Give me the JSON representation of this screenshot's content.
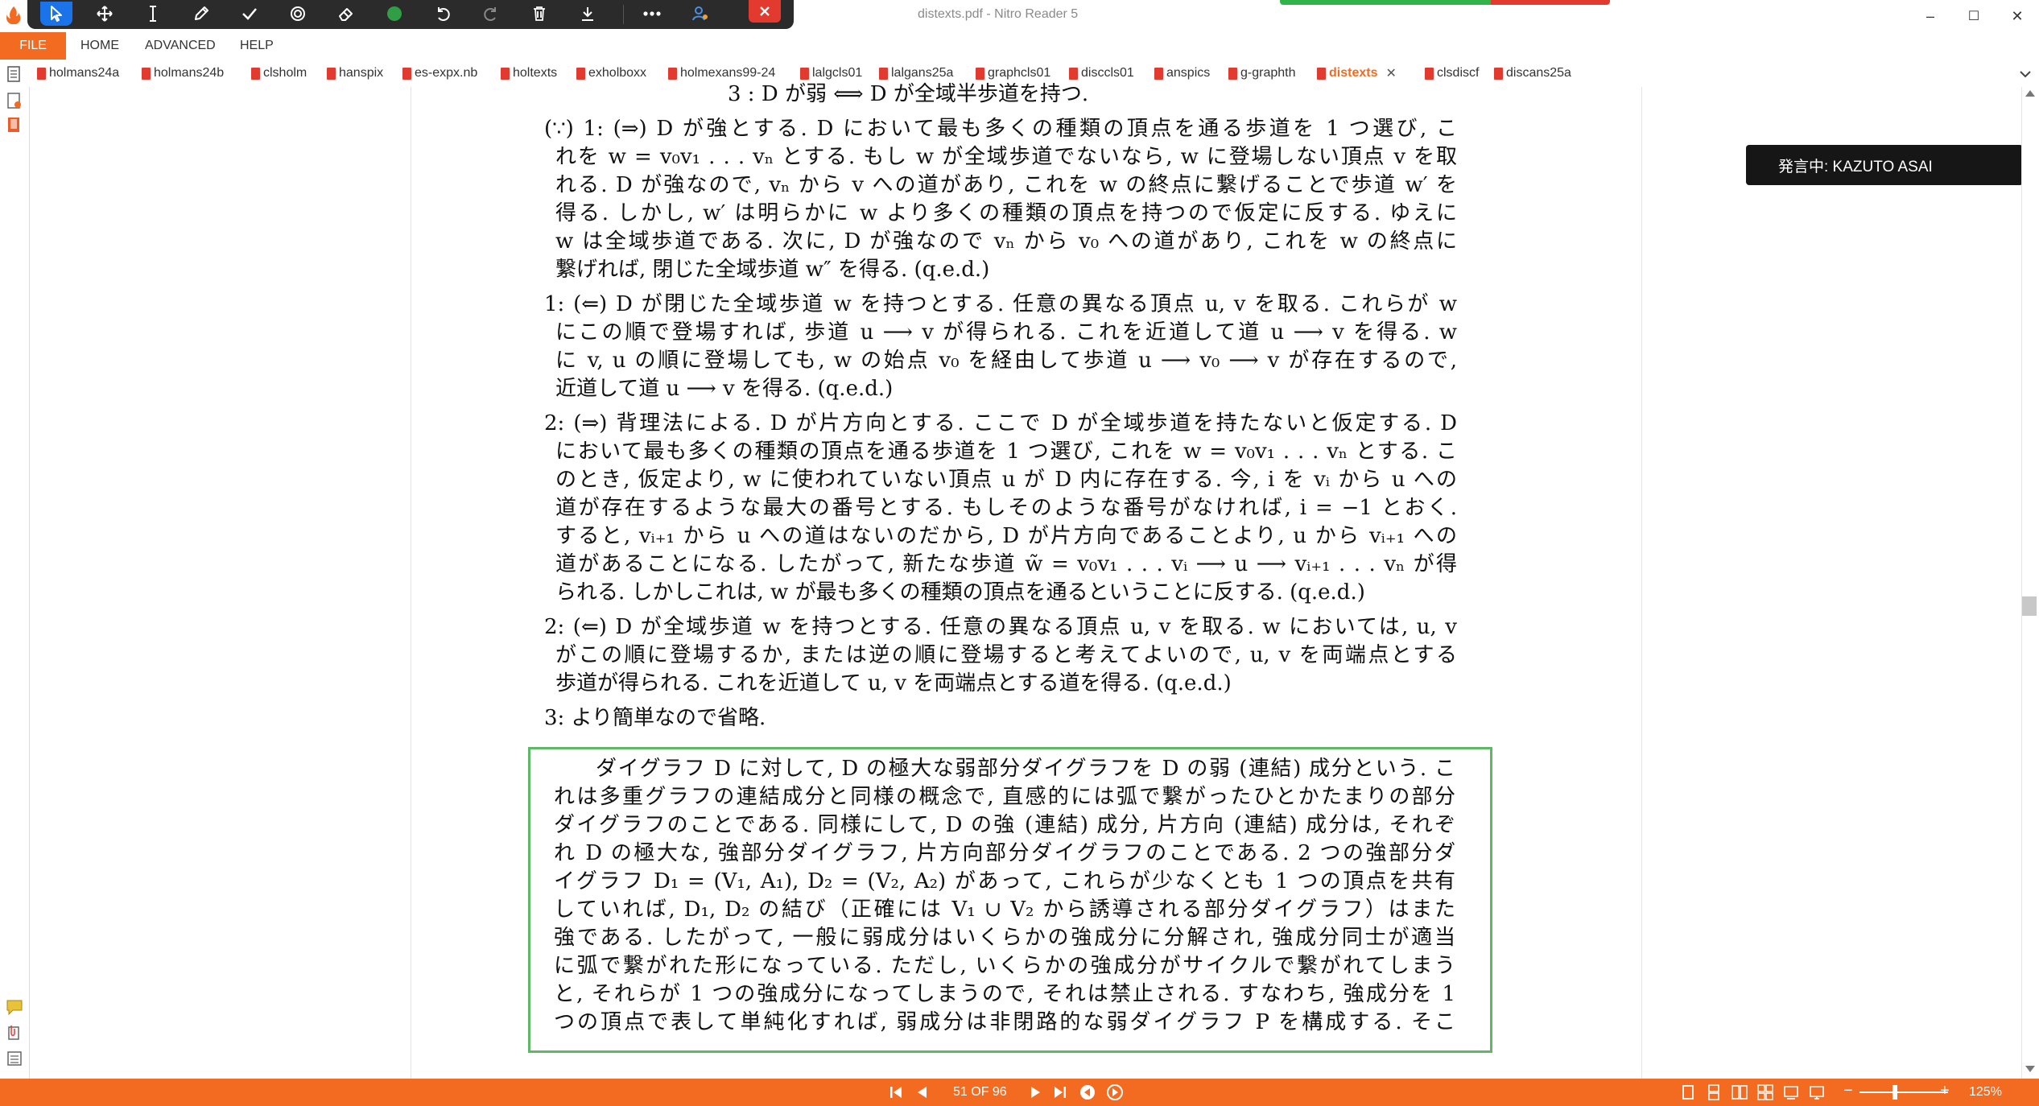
{
  "window": {
    "title": "distexts.pdf - Nitro Reader 5",
    "minimize": "–",
    "maximize": "☐",
    "close": "✕"
  },
  "toolbar": {
    "tools": [
      "select-arrow-icon",
      "pan-icon",
      "text-cursor-icon",
      "pen-icon",
      "check-icon",
      "stamp-icon",
      "eraser-icon",
      "color-dot-icon",
      "undo-icon",
      "redo-icon",
      "trash-icon",
      "download-icon",
      "more-icon",
      "user-icon",
      "close-icon"
    ],
    "active_color": "#1a73e8",
    "dot_color": "#2f9e44"
  },
  "menu": {
    "file": "FILE",
    "home": "HOME",
    "advanced": "ADVANCED",
    "help": "HELP"
  },
  "tabs": [
    {
      "label": "holmans24a"
    },
    {
      "label": "holmans24b"
    },
    {
      "label": "clsholm"
    },
    {
      "label": "hanspix"
    },
    {
      "label": "es-expx.nb"
    },
    {
      "label": "holtexts"
    },
    {
      "label": "exholboxx"
    },
    {
      "label": "holmexans99-24"
    },
    {
      "label": "lalgcls01"
    },
    {
      "label": "lalgans25a"
    },
    {
      "label": "graphcls01"
    },
    {
      "label": "disccls01"
    },
    {
      "label": "anspics"
    },
    {
      "label": "g-graphth"
    },
    {
      "label": "distexts",
      "active": true
    },
    {
      "label": "clsdiscf"
    },
    {
      "label": "discans25a"
    }
  ],
  "document": {
    "top_line": "3 :  D が弱         ⟺    D が全域半歩道を持つ.",
    "paragraphs": [
      [
        "(∵) 1: (⇒) D が強とする. D において最も多くの種類の頂点を通る歩道を 1 つ選び, こ",
        "れを w = v₀v₁ . . . vₙ とする. もし w が全域歩道でないなら, w に登場しない頂点 v を取",
        "れる. D が強なので, vₙ から v への道があり, これを w の終点に繋げることで歩道 w′ を",
        "得る. しかし, w′ は明らかに w より多くの種類の頂点を持つので仮定に反する. ゆえに",
        "w は全域歩道である. 次に, D が強なので vₙ から v₀ への道があり, これを w の終点に",
        "繋げれば, 閉じた全域歩道 w″ を得る.   (q.e.d.)"
      ],
      [
        "1: (⇐) D が閉じた全域歩道 w を持つとする. 任意の異なる頂点 u, v を取る. これらが w",
        "にこの順で登場すれば, 歩道 u ⟶ v が得られる. これを近道して道 u ⟶ v を得る. w",
        "に v, u の順に登場しても, w の始点 v₀ を経由して歩道 u ⟶ v₀ ⟶ v が存在するので,",
        "近道して道 u ⟶ v を得る.   (q.e.d.)"
      ],
      [
        "2: (⇒) 背理法による. D が片方向とする. ここで D が全域歩道を持たないと仮定する. D",
        "において最も多くの種類の頂点を通る歩道を 1 つ選び, これを w = v₀v₁ . . . vₙ とする. こ",
        "のとき, 仮定より, w に使われていない頂点 u が D 内に存在する. 今, i を vᵢ から u への",
        "道が存在するような最大の番号とする. もしそのような番号がなければ, i = −1 とおく.",
        "すると, vᵢ₊₁ から u への道はないのだから, D が片方向であることより, u から vᵢ₊₁ への",
        "道があることになる. したがって, 新たな歩道 w̃ = v₀v₁ . . . vᵢ ⟶ u ⟶ vᵢ₊₁ . . . vₙ が得",
        "られる. しかしこれは, w が最も多くの種類の頂点を通るということに反する.   (q.e.d.)"
      ],
      [
        "2: (⇐) D が全域歩道 w を持つとする. 任意の異なる頂点 u, v を取る. w においては, u, v",
        "がこの順に登場するか, または逆の順に登場すると考えてよいので, u, v を両端点とする",
        "歩道が得られる. これを近道して u, v を両端点とする道を得る.   (q.e.d.)"
      ],
      [
        "3: より簡単なので省略."
      ]
    ],
    "highlight": [
      "ダイグラフ D に対して, D の極大な弱部分ダイグラフを D の弱 (連結) 成分という. こ",
      "れは多重グラフの連結成分と同様の概念で, 直感的には弧で繋がったひとかたまりの部分",
      "ダイグラフのことである. 同様にして, D の強 (連結) 成分, 片方向 (連結) 成分は, それぞ",
      "れ D の極大な, 強部分ダイグラフ, 片方向部分ダイグラフのことである. 2 つの強部分ダ",
      "イグラフ D₁ = (V₁, A₁), D₂ = (V₂, A₂) があって, これらが少なくとも 1 つの頂点を共有",
      "していれば, D₁, D₂ の結び（正確には V₁ ∪ V₂ から誘導される部分ダイグラフ）はまた",
      "強である. したがって, 一般に弱成分はいくらかの強成分に分解され, 強成分同士が適当",
      "に弧で繋がれた形になっている. ただし, いくらかの強成分がサイクルで繋がれてしまう",
      "と, それらが 1 つの強成分になってしまうので, それは禁止される. すなわち, 強成分を 1",
      "つの頂点で表して単純化すれば, 弱成分は非閉路的な弱ダイグラフ P を構成する. そこ"
    ],
    "highlight_color": "#5fb865"
  },
  "speaking_badge": "発言中: KAZUTO ASAI",
  "status": {
    "page_indicator": "51 OF 96",
    "zoom": "125%",
    "zoom_fraction": 0.4,
    "bar_color": "#f26b21"
  }
}
